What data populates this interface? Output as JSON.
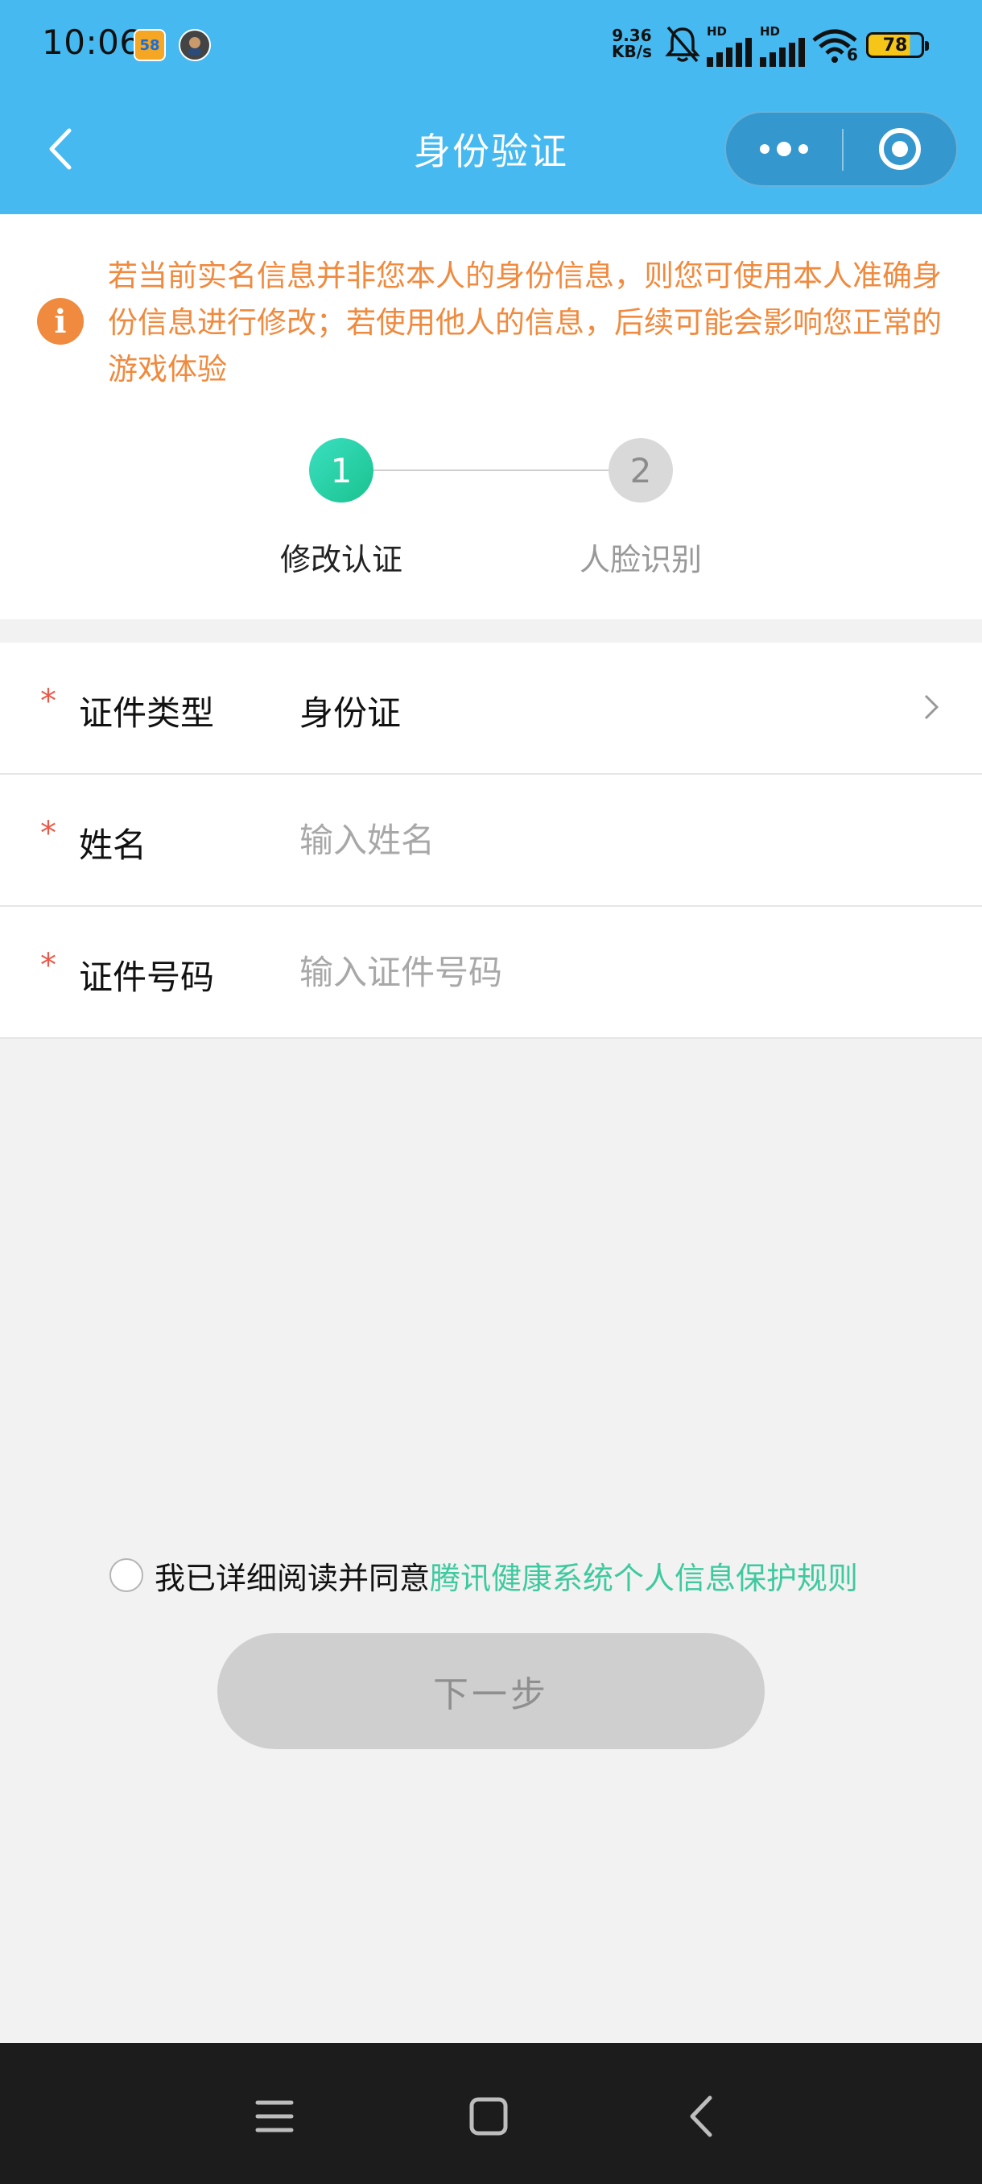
{
  "status_bar": {
    "time": "10:06",
    "app_badge_58": "58",
    "net_speed_value": "9.36",
    "net_speed_unit": "KB/s",
    "signal_label_1": "HD",
    "signal_label_2": "HD",
    "wifi_label": "6",
    "battery_level": "78"
  },
  "nav": {
    "title": "身份验证",
    "back_icon": "chevron-left-icon",
    "more_icon": "more-dots-icon",
    "close_icon": "target-circle-icon"
  },
  "notice": {
    "icon": "info-icon",
    "icon_glyph": "i",
    "text": "若当前实名信息并非您本人的身份信息，则您可使用本人准确身份信息进行修改；若使用他人的信息，后续可能会影响您正常的游戏体验"
  },
  "steps": [
    {
      "number": "1",
      "label": "修改认证",
      "active": true
    },
    {
      "number": "2",
      "label": "人脸识别",
      "active": false
    }
  ],
  "form": {
    "required_mark": "*",
    "id_type": {
      "label": "证件类型",
      "value": "身份证"
    },
    "name": {
      "label": "姓名",
      "placeholder": "输入姓名",
      "value": ""
    },
    "id_number": {
      "label": "证件号码",
      "placeholder": "输入证件号码",
      "value": ""
    }
  },
  "agreement": {
    "checked": false,
    "prefix": "我已详细阅读并同意",
    "link_text": "腾讯健康系统个人信息保护规则"
  },
  "next_button": {
    "label": "下一步",
    "enabled": false
  },
  "colors": {
    "header": "#45b9f0",
    "notice": "#f08a3e",
    "accent_green": "#3fc99f",
    "required": "#e8594a",
    "button_disabled": "#cfcfcf"
  }
}
